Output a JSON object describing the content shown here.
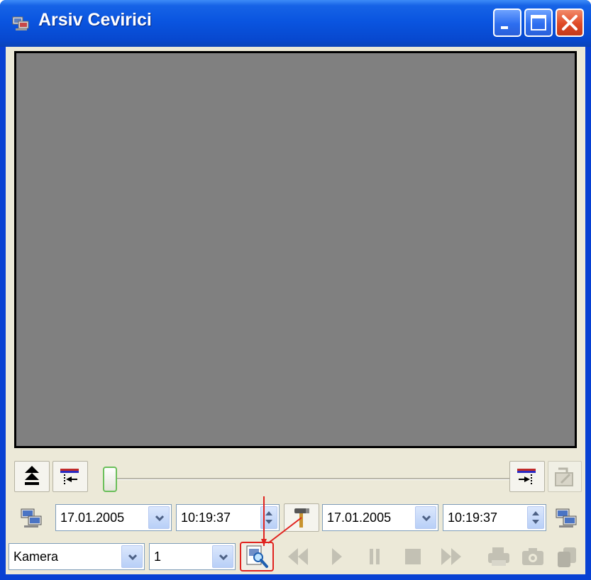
{
  "window": {
    "title": "Arsiv Cevirici",
    "title_icon": "app-cameras-icon",
    "controls": [
      "minimize-icon",
      "maximize-icon",
      "close-icon"
    ]
  },
  "slider": {
    "position": 0.0
  },
  "range": {
    "start_date": "17.01.2005",
    "start_time": "10:19:37",
    "end_date": "17.01.2005",
    "end_time": "10:19:37"
  },
  "source": {
    "camera_label": "Kamera",
    "camera_number": "1"
  },
  "colors": {
    "video_background": "#808080",
    "highlight": "#e0231f",
    "titlebar": "#0a55e0"
  }
}
